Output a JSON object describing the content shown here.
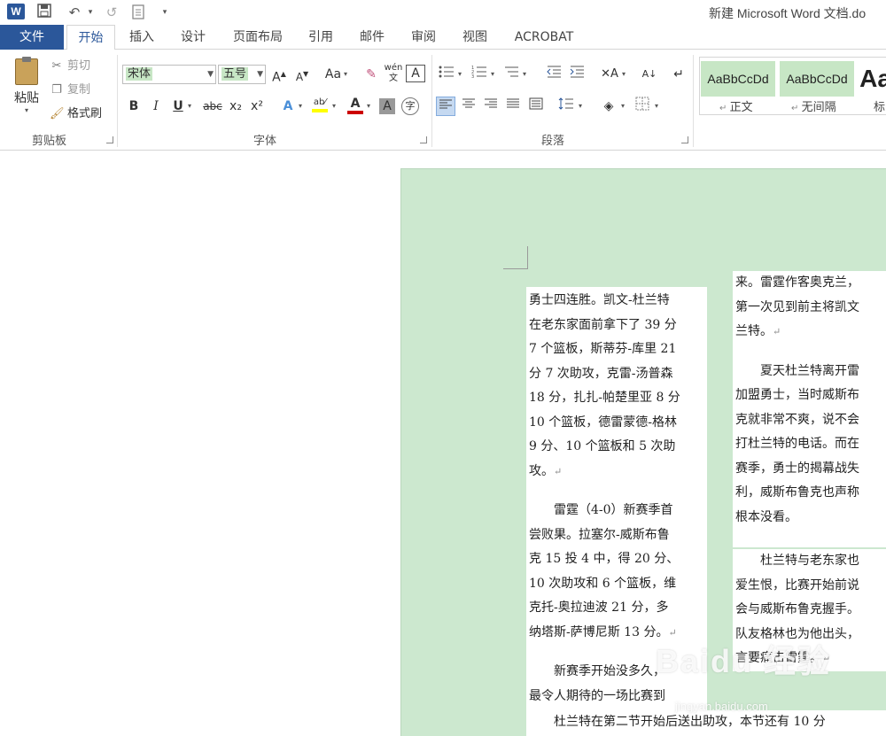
{
  "window": {
    "title": "新建 Microsoft Word 文档.do",
    "logo": "W"
  },
  "qat": {
    "save_icon": "save-icon",
    "undo_icon": "undo-icon",
    "redo_icon": "redo-icon",
    "touch_icon": "touch-mode-icon",
    "customize_icon": "customize-qat-icon"
  },
  "tabs": [
    {
      "label": "文件"
    },
    {
      "label": "开始"
    },
    {
      "label": "插入"
    },
    {
      "label": "设计"
    },
    {
      "label": "页面布局"
    },
    {
      "label": "引用"
    },
    {
      "label": "邮件"
    },
    {
      "label": "审阅"
    },
    {
      "label": "视图"
    },
    {
      "label": "ACROBAT"
    }
  ],
  "clipboard": {
    "paste": "粘贴",
    "cut": "剪切",
    "copy": "复制",
    "format_painter": "格式刷",
    "group": "剪贴板"
  },
  "font": {
    "name": "宋体",
    "size": "五号",
    "group": "字体",
    "bold": "B",
    "italic": "I",
    "underline": "U",
    "strike": "abc",
    "sub": "x₂",
    "sup": "x²",
    "case": "Aa",
    "grow": "A",
    "shrink": "A",
    "font_color": "#cc0000",
    "highlight_color": "#ffff00"
  },
  "paragraph": {
    "group": "段落"
  },
  "styles": [
    {
      "preview": "AaBbCcDd",
      "name": "正文"
    },
    {
      "preview": "AaBbCcDd",
      "name": "无间隔"
    },
    {
      "preview": "Aa",
      "name": "标"
    }
  ],
  "document": {
    "col1": [
      "勇士四连胜。凯文-杜兰特",
      "在老东家面前拿下了 39 分",
      "7 个篮板，斯蒂芬-库里 21",
      "分 7 次助攻，克雷-汤普森",
      "18 分，扎扎-帕楚里亚 8 分",
      "10 个篮板，德雷蒙德-格林",
      "9 分、10 个篮板和 5 次助",
      "攻。",
      "",
      "　　雷霆（4-0）新赛季首",
      "尝败果。拉塞尔-威斯布鲁",
      "克 15 投 4 中，得 20 分、",
      "10 次助攻和 6 个篮板，维",
      "克托-奥拉迪波 21 分，多",
      "纳塔斯-萨博尼斯 13 分。",
      "",
      "　　新赛季开始没多久，",
      "最令人期待的一场比赛到"
    ],
    "col2a": [
      "来。雷霆作客奥克兰，",
      "第一次见到前主将凯文",
      "兰特。",
      "",
      "　　夏天杜兰特离开雷",
      "加盟勇士，当时威斯布",
      "克就非常不爽，说不会",
      "打杜兰特的电话。而在",
      "赛季，勇士的揭幕战失",
      "利，威斯布鲁克也声称",
      "根本没看。"
    ],
    "col2b": [
      "　　杜兰特与老东家也",
      "爱生恨，比赛开始前说",
      "会与威斯布鲁克握手。",
      "队友格林也为他出头，",
      "言要痛击雷霆。"
    ],
    "bottom_line": "　　杜兰特在第二节开始后送出助攻，本节还有 10 分"
  },
  "watermark": {
    "main": "Baidu 经验",
    "sub": "jingyan.baidu.com"
  }
}
